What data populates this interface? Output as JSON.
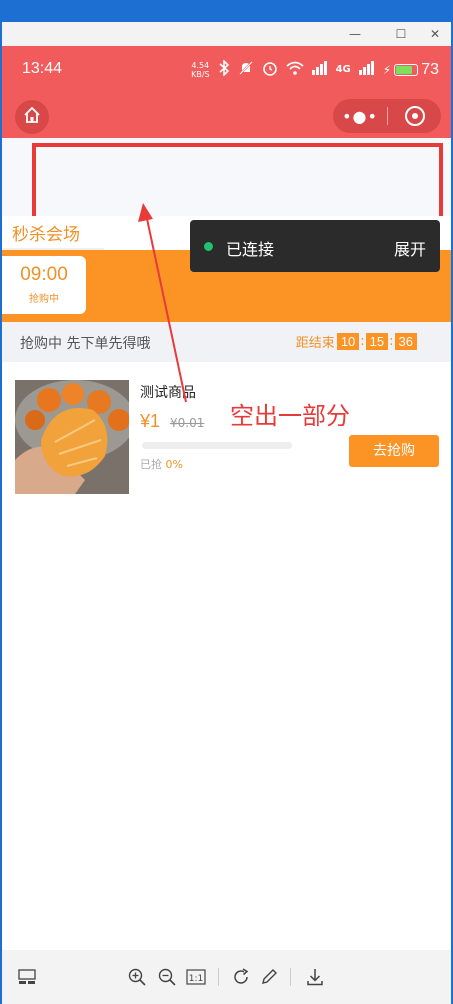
{
  "window": {
    "minimize": "—",
    "maximize": "☐",
    "close": "✕"
  },
  "status": {
    "time": "13:44",
    "net_speed_top": "4.54",
    "net_speed_bottom": "KB/S",
    "signal_1": "4G",
    "battery": "73",
    "battery_level": 0.73
  },
  "page": {
    "tab_label": "秒杀会场",
    "slot_time": "09:00",
    "slot_status": "抢购中",
    "info_left": "抢购中 先下单先得哦",
    "countdown_label": "距结束",
    "cd_h": "10",
    "cd_m": "15",
    "cd_s": "36"
  },
  "debug_panel": {
    "status": "已连接",
    "expand": "展开"
  },
  "goods": {
    "name": "测试商品",
    "price": "¥1",
    "old_price": "¥0.01",
    "sold_label": "已抢",
    "sold_pct": "0%",
    "progress": 0,
    "buy": "去抢购"
  },
  "annotation": {
    "text": "空出一部分",
    "color": "#e93a3a"
  },
  "colors": {
    "header": "#f25b5b",
    "accent": "#fb9325",
    "connected_dot": "#1fc36b"
  }
}
